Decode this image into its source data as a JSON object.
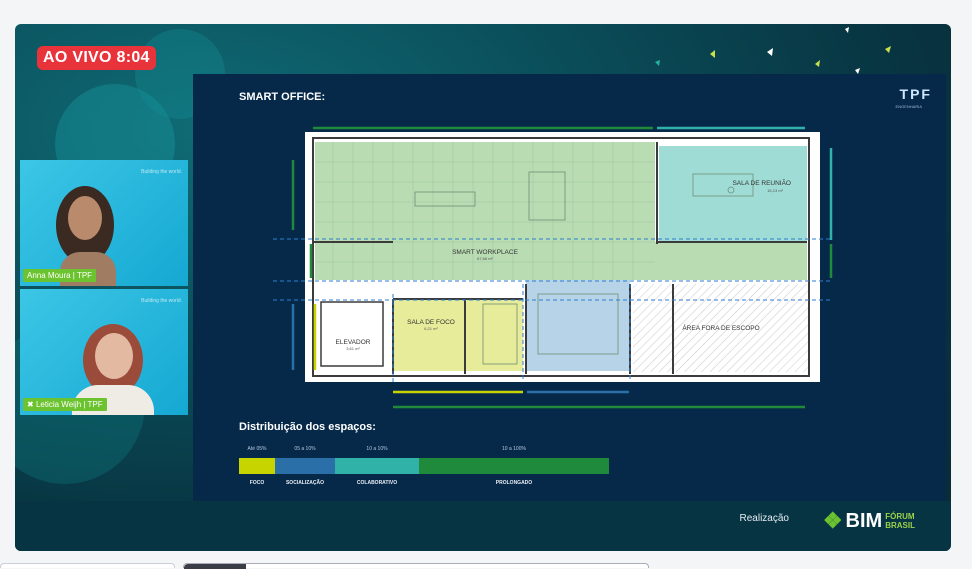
{
  "live_badge": "AO VIVO 8:04",
  "participants": [
    {
      "name": "Anna Moura | TPF",
      "watermark": "Building the world."
    },
    {
      "name": "Leticia Weijh | TPF",
      "watermark": "Building the world."
    }
  ],
  "slide": {
    "title": "SMART OFFICE:",
    "logo": "TPF",
    "logo_sub": "ENGENHARIA",
    "floorplan": {
      "rooms": [
        {
          "label": "SALA DE REUNIÃO",
          "area": "15,13 m²"
        },
        {
          "label": "SMART WORKPLACE",
          "area": "67,66 m²"
        },
        {
          "label": "SALA DE FOCO",
          "area": "6,21 m²"
        },
        {
          "label": "ELEVADOR",
          "area": "3,61 m²"
        },
        {
          "label": "ÁREA FORA DE ESCOPO",
          "area": ""
        }
      ]
    },
    "distribution": {
      "title": "Distribuição dos espaços:",
      "segments": [
        {
          "top": "Até 05%",
          "label": "FOCO",
          "color": "#c8d400"
        },
        {
          "top": "05 a 10%",
          "label": "SOCIALIZAÇÃO",
          "color": "#2b6fa8"
        },
        {
          "top": "10 a 10%",
          "label": "COLABORATIVO",
          "color": "#30b2a9"
        },
        {
          "top": "10 a 100%",
          "label": "PROLONGADO",
          "color": "#1f8a3c"
        }
      ]
    }
  },
  "footer": {
    "realizacao": "Realização",
    "brand": "BIM",
    "brand_line1": "FÓRUM",
    "brand_line2": "BRASIL"
  }
}
